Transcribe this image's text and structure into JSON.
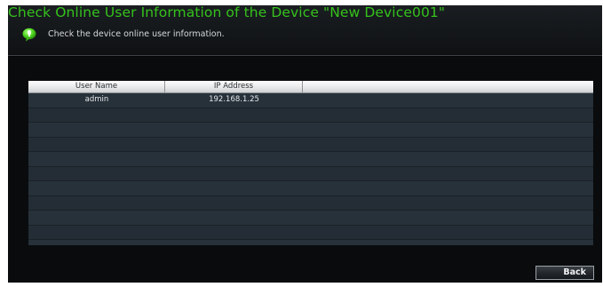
{
  "header": {
    "title": "Check Online User Information of the Device \"New Device001\"",
    "subtitle": "Check the device online user information.",
    "title_color": "#35c21c",
    "icon": "info-bubble-icon"
  },
  "table": {
    "columns": [
      "User Name",
      "IP Address",
      ""
    ],
    "rows": [
      {
        "user": "admin",
        "ip": "192.168.1.25"
      },
      {
        "user": "",
        "ip": ""
      },
      {
        "user": "",
        "ip": ""
      },
      {
        "user": "",
        "ip": ""
      },
      {
        "user": "",
        "ip": ""
      },
      {
        "user": "",
        "ip": ""
      },
      {
        "user": "",
        "ip": ""
      },
      {
        "user": "",
        "ip": ""
      },
      {
        "user": "",
        "ip": ""
      },
      {
        "user": "",
        "ip": ""
      },
      {
        "user": "",
        "ip": ""
      }
    ]
  },
  "footer": {
    "back_label": "Back"
  }
}
